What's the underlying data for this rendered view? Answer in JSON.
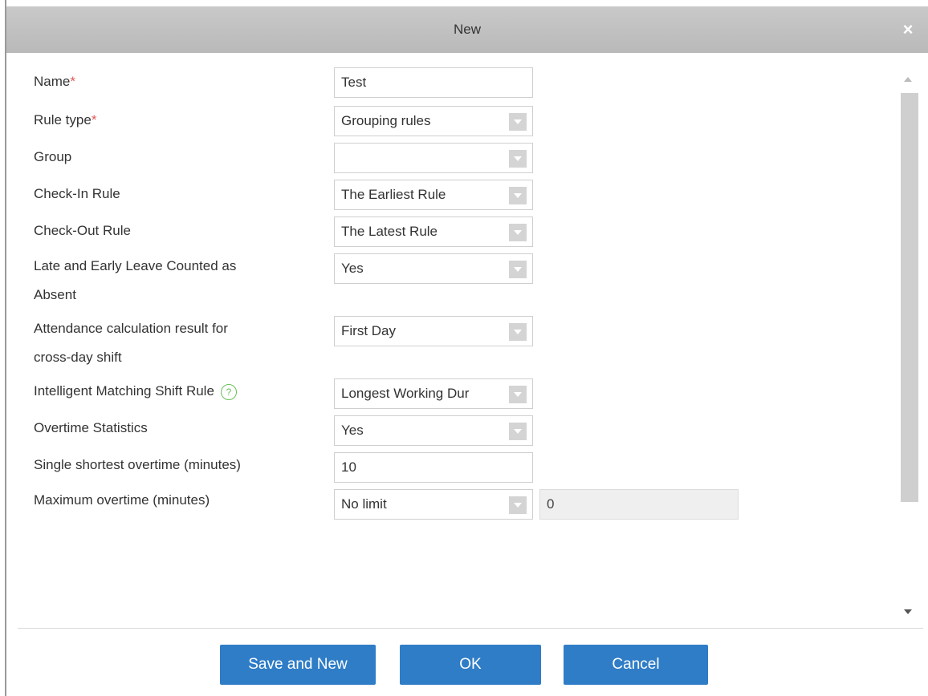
{
  "dialog": {
    "title": "New",
    "close_label": "×"
  },
  "form": {
    "name": {
      "label": "Name",
      "required_mark": "*",
      "value": "Test"
    },
    "rule_type": {
      "label": "Rule type",
      "required_mark": "*",
      "value": "Grouping rules"
    },
    "group": {
      "label": "Group",
      "value": ""
    },
    "check_in_rule": {
      "label": "Check-In Rule",
      "value": "The Earliest Rule"
    },
    "check_out_rule": {
      "label": "Check-Out Rule",
      "value": "The Latest Rule"
    },
    "late_early_absent": {
      "label_line1": "Late and Early Leave Counted as",
      "label_line2": "Absent",
      "value": "Yes"
    },
    "cross_day": {
      "label_line1": "Attendance calculation result for",
      "label_line2": "cross-day shift",
      "value": "First Day"
    },
    "intelligent_matching": {
      "label": "Intelligent Matching Shift Rule",
      "help_glyph": "?",
      "value": "Longest Working Dur"
    },
    "overtime_statistics": {
      "label": "Overtime Statistics",
      "value": "Yes"
    },
    "single_shortest_overtime": {
      "label": "Single shortest overtime (minutes)",
      "value": "10"
    },
    "maximum_overtime": {
      "label": "Maximum overtime (minutes)",
      "value": "No limit",
      "limit_value": "0"
    }
  },
  "buttons": {
    "save_and_new": "Save and New",
    "ok": "OK",
    "cancel": "Cancel"
  },
  "colors": {
    "primary_button": "#2f7dc7",
    "required": "#e05a5a",
    "help_icon": "#6cbf5a",
    "titlebar": "#c2c2c2"
  }
}
